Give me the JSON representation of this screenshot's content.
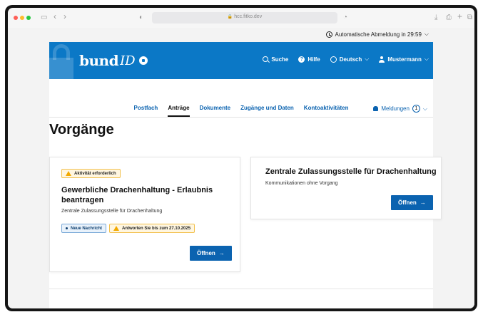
{
  "browser": {
    "url": "hcc.fitko.dev",
    "tabs_icon": "sidebar-icon",
    "back": "‹",
    "forward": "›",
    "share": "⎙",
    "plus": "+",
    "copy": "⧉",
    "download": "⤓",
    "shield": "◐",
    "reader": "◔"
  },
  "topbar": {
    "logout_text": "Automatische Abmeldung in 29:59",
    "chevron": "⌵"
  },
  "header": {
    "logo_bund": "bund",
    "logo_id": "ID",
    "search": "Suche",
    "help": "Hilfe",
    "help_glyph": "?",
    "language": "Deutsch",
    "user": "Mustermann",
    "chevron": "⌵"
  },
  "tabs": [
    {
      "label": "Postfach"
    },
    {
      "label": "Anträge"
    },
    {
      "label": "Dokumente"
    },
    {
      "label": "Zugänge und Daten"
    },
    {
      "label": "Kontoaktivitäten"
    }
  ],
  "notifications": {
    "label": "Meldungen",
    "count": "1",
    "chevron": "⌵"
  },
  "main": {
    "title": "Vorgänge"
  },
  "cards": [
    {
      "status": "Aktivität erforderlich",
      "title": "Gewerbliche Drachenhaltung - Erlaubnis beantragen",
      "subtitle": "Zentrale Zulassungsstelle für Drachenhaltung",
      "badge_info": "Neue Nachricht",
      "badge_warn": "Antworten Sie bis zum 27.10.2025",
      "button": "Öffnen",
      "arrow": "→"
    },
    {
      "title": "Zentrale Zulassungsstelle für Drachenhaltung",
      "subtitle": "Kommunikationen ohne Vorgang",
      "button": "Öffnen",
      "arrow": "→"
    }
  ],
  "colors": {
    "brand_blue": "#0b78c6",
    "link_blue": "#0b63b0",
    "warn": "#f2a900"
  }
}
